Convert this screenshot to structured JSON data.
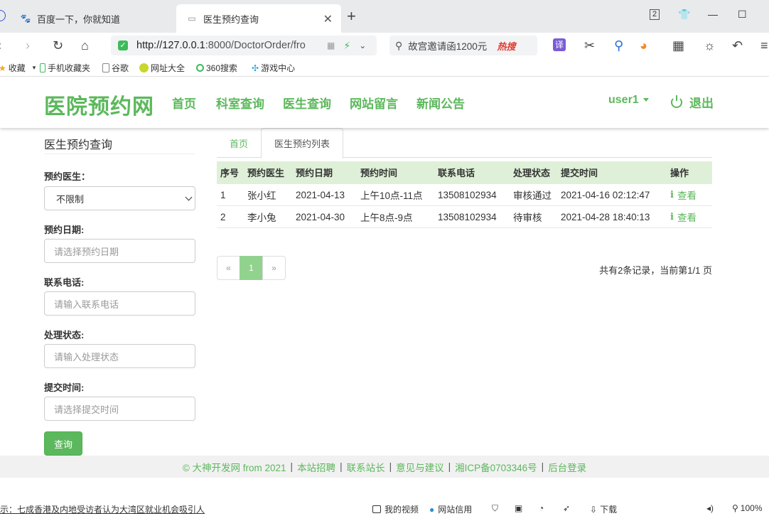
{
  "browser": {
    "tabs": [
      {
        "label": "百度一下，你就知道",
        "active": false
      },
      {
        "label": "医生预约查询",
        "active": true
      }
    ],
    "tab_count": "2",
    "url_host": "http://127.0.0.1",
    "url_rest": ":8000/DoctorOrder/fro",
    "search_text": "故宫邀请函1200元",
    "search_hot": "热搜",
    "bookmarks": [
      "收藏",
      "手机收藏夹",
      "谷歌",
      "网址大全",
      "360搜索",
      "游戏中心"
    ],
    "status_text": "示：七成香港及内地受访者认为大湾区就业机会吸引人",
    "status_items": [
      "我的视频",
      "网站信用",
      "下载",
      "100%"
    ]
  },
  "site": {
    "brand": "医院预约网",
    "nav": [
      "首页",
      "科室查询",
      "医生查询",
      "网站留言",
      "新闻公告"
    ],
    "user": "user1",
    "logout": "退出"
  },
  "sidebar": {
    "title": "医生预约查询",
    "doctor_label": "预约医生：",
    "doctor_value": "不限制",
    "date_label": "预约日期:",
    "date_placeholder": "请选择预约日期",
    "phone_label": "联系电话:",
    "phone_placeholder": "请输入联系电话",
    "status_label": "处理状态:",
    "status_placeholder": "请输入处理状态",
    "submit_label": "提交时间:",
    "submit_placeholder": "请选择提交时间",
    "query_button": "查询"
  },
  "content": {
    "tabs": [
      "首页",
      "医生预约列表"
    ],
    "columns": [
      "序号",
      "预约医生",
      "预约日期",
      "预约时间",
      "联系电话",
      "处理状态",
      "提交时间",
      "操作"
    ],
    "rows": [
      [
        "1",
        "张小红",
        "2021-04-13",
        "上午10点-11点",
        "13508102934",
        "审核通过",
        "2021-04-16 02:12:47",
        "查看"
      ],
      [
        "2",
        "李小兔",
        "2021-04-30",
        "上午8点-9点",
        "13508102934",
        "待审核",
        "2021-04-28 18:40:13",
        "查看"
      ]
    ],
    "pager": {
      "prev": "«",
      "current": "1",
      "next": "»"
    },
    "record_info": "共有2条记录，当前第1/1 页"
  },
  "footer": {
    "items": [
      "© 大神开发网 from 2021",
      "本站招聘",
      "联系站长",
      "意见与建议",
      "湘ICP备0703346号",
      "后台登录"
    ],
    "separator": "|"
  },
  "colors": {
    "accent": "#5cb85c",
    "table_head": "#dff0d8",
    "pager_active": "#92d28f"
  }
}
